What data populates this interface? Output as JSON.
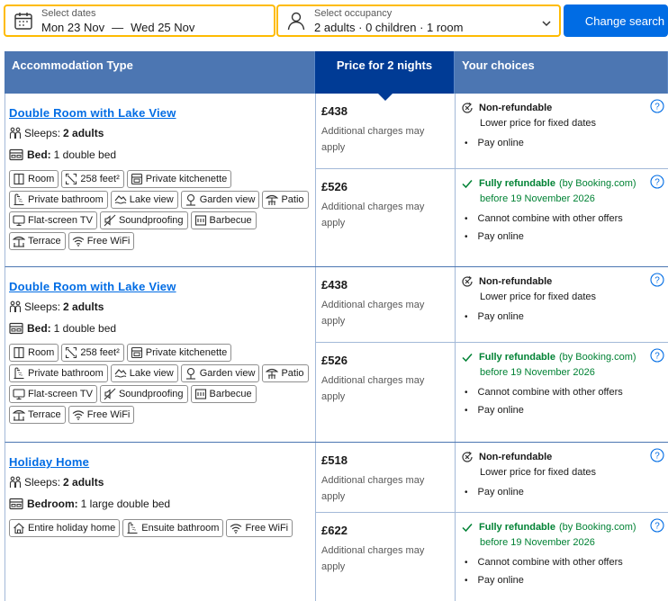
{
  "search": {
    "dates_label": "Select dates",
    "date_from": "Mon 23 Nov",
    "date_sep": "—",
    "date_to": "Wed 25 Nov",
    "occupancy_label": "Select occupancy",
    "occupancy_value": "2 adults · 0 children · 1 room",
    "button_label": "Change search",
    "accent_color": "#febb02",
    "button_color": "#006ce4"
  },
  "table": {
    "headers": {
      "type": "Accommodation Type",
      "price": "Price for 2 nights",
      "choices": "Your choices"
    },
    "header_color": "#4c76b2",
    "active_header_color": "#003b95"
  },
  "rooms": [
    {
      "name": "Double Room with Lake View",
      "sleeps_label": "Sleeps:",
      "sleeps_value": "2 adults",
      "bed_label": "Bed:",
      "bed_value": "1 double bed",
      "facilities": [
        {
          "label": "Room",
          "icon": "room-size-icon"
        },
        {
          "label": "258 feet²",
          "icon": "area-icon"
        },
        {
          "label": "Private kitchenette",
          "icon": "kitchenette-icon"
        },
        {
          "label": "Private bathroom",
          "icon": "bathroom-icon"
        },
        {
          "label": "Lake view",
          "icon": "lake-view-icon"
        },
        {
          "label": "Garden view",
          "icon": "garden-view-icon"
        },
        {
          "label": "Patio",
          "icon": "patio-icon"
        },
        {
          "label": "Flat-screen TV",
          "icon": "tv-icon"
        },
        {
          "label": "Soundproofing",
          "icon": "soundproofing-icon"
        },
        {
          "label": "Barbecue",
          "icon": "barbecue-icon"
        },
        {
          "label": "Terrace",
          "icon": "terrace-icon"
        },
        {
          "label": "Free WiFi",
          "icon": "wifi-icon"
        }
      ],
      "options": [
        {
          "price": "£438",
          "charges": "Additional charges may apply",
          "policy": "Non-refundable",
          "policy_type": "nonref",
          "policy_sub": "Lower price for fixed dates",
          "bullets": [
            "Pay online"
          ]
        },
        {
          "price": "£526",
          "charges": "Additional charges may apply",
          "policy": "Fully refundable",
          "policy_type": "refund",
          "policy_by": "(by Booking.com)",
          "policy_sub": "before 19 November 2026",
          "bullets": [
            "Cannot combine with other offers",
            "Pay online"
          ]
        }
      ]
    },
    {
      "name": "Double Room with Lake View",
      "sleeps_label": "Sleeps:",
      "sleeps_value": "2 adults",
      "bed_label": "Bed:",
      "bed_value": "1 double bed",
      "facilities": [
        {
          "label": "Room",
          "icon": "room-size-icon"
        },
        {
          "label": "258 feet²",
          "icon": "area-icon"
        },
        {
          "label": "Private kitchenette",
          "icon": "kitchenette-icon"
        },
        {
          "label": "Private bathroom",
          "icon": "bathroom-icon"
        },
        {
          "label": "Lake view",
          "icon": "lake-view-icon"
        },
        {
          "label": "Garden view",
          "icon": "garden-view-icon"
        },
        {
          "label": "Patio",
          "icon": "patio-icon"
        },
        {
          "label": "Flat-screen TV",
          "icon": "tv-icon"
        },
        {
          "label": "Soundproofing",
          "icon": "soundproofing-icon"
        },
        {
          "label": "Barbecue",
          "icon": "barbecue-icon"
        },
        {
          "label": "Terrace",
          "icon": "terrace-icon"
        },
        {
          "label": "Free WiFi",
          "icon": "wifi-icon"
        }
      ],
      "options": [
        {
          "price": "£438",
          "charges": "Additional charges may apply",
          "policy": "Non-refundable",
          "policy_type": "nonref",
          "policy_sub": "Lower price for fixed dates",
          "bullets": [
            "Pay online"
          ]
        },
        {
          "price": "£526",
          "charges": "Additional charges may apply",
          "policy": "Fully refundable",
          "policy_type": "refund",
          "policy_by": "(by Booking.com)",
          "policy_sub": "before 19 November 2026",
          "bullets": [
            "Cannot combine with other offers",
            "Pay online"
          ]
        }
      ]
    },
    {
      "name": "Holiday Home",
      "sleeps_label": "Sleeps:",
      "sleeps_value": "2 adults",
      "bed_label": "Bedroom:",
      "bed_value": "1 large double bed",
      "facilities": [
        {
          "label": "Entire holiday home",
          "icon": "home-icon"
        },
        {
          "label": "Ensuite bathroom",
          "icon": "bathroom-icon"
        },
        {
          "label": "Free WiFi",
          "icon": "wifi-icon"
        }
      ],
      "options": [
        {
          "price": "£518",
          "charges": "Additional charges may apply",
          "policy": "Non-refundable",
          "policy_type": "nonref",
          "policy_sub": "Lower price for fixed dates",
          "bullets": [
            "Pay online"
          ]
        },
        {
          "price": "£622",
          "charges": "Additional charges may apply",
          "policy": "Fully refundable",
          "policy_type": "refund",
          "policy_by": "(by Booking.com)",
          "policy_sub": "before 19 November 2026",
          "bullets": [
            "Cannot combine with other offers",
            "Pay online"
          ]
        }
      ]
    }
  ]
}
